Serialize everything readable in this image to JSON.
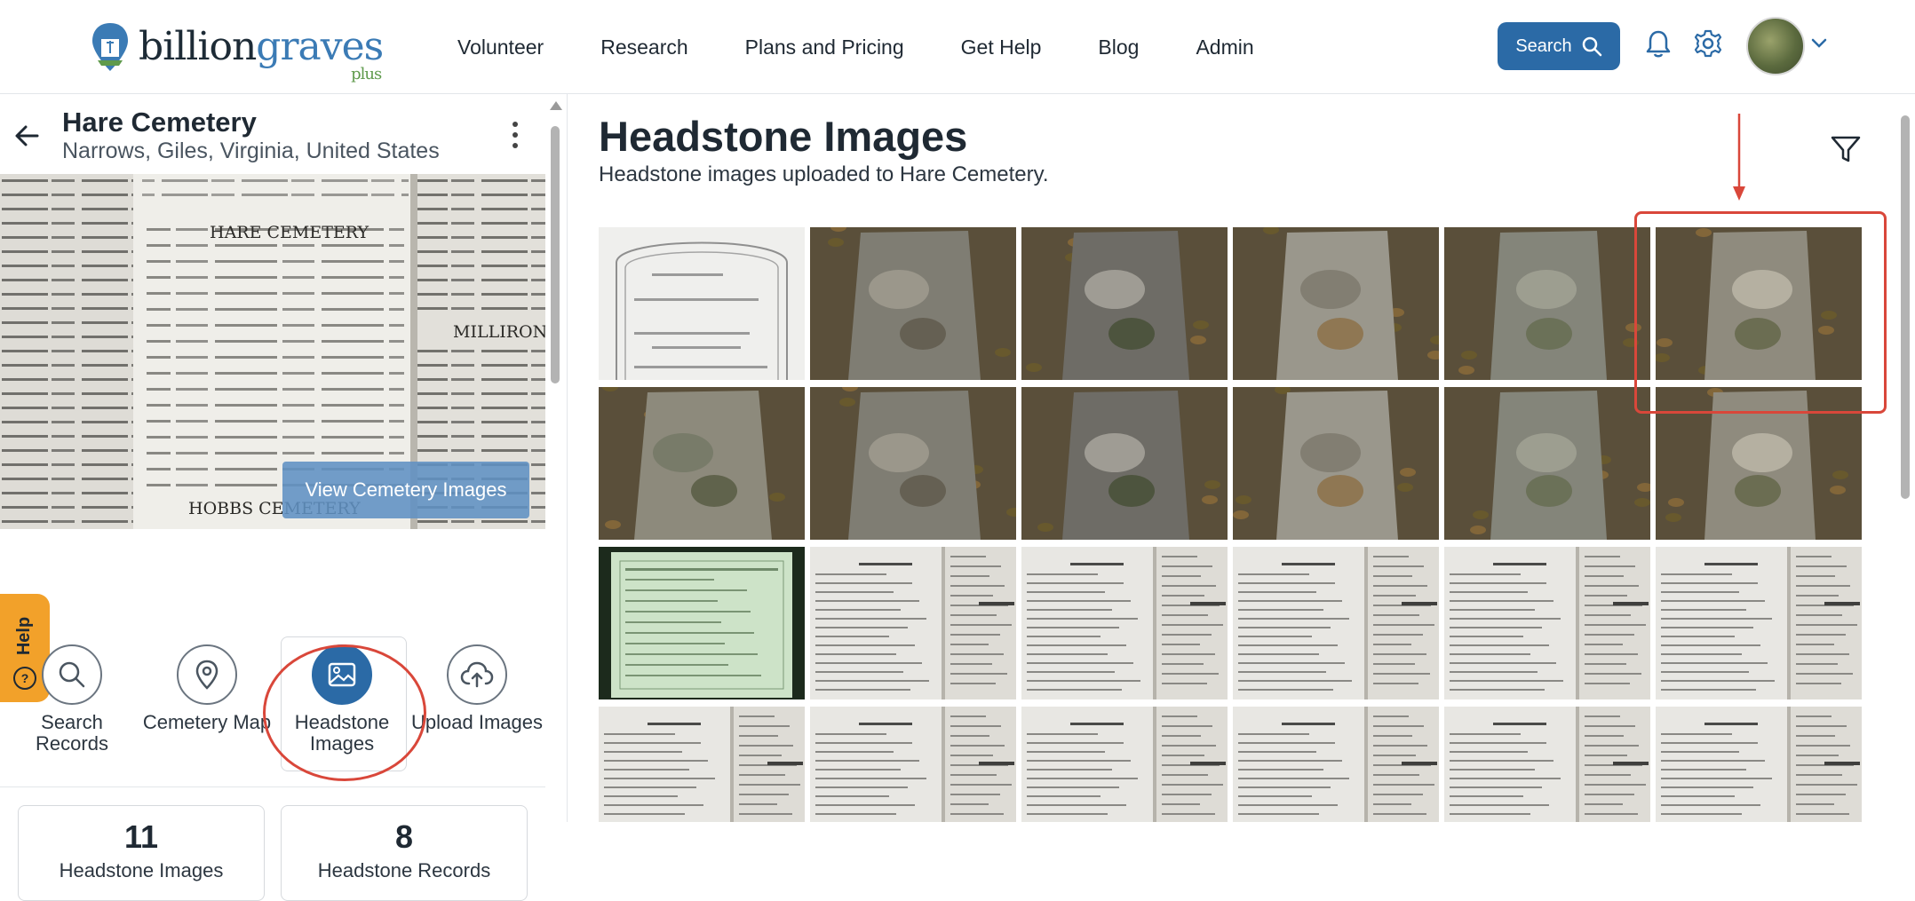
{
  "header": {
    "logo_text_dark": "billion",
    "logo_text_blue": "graves",
    "logo_plus": "plus",
    "nav": [
      "Volunteer",
      "Research",
      "Plans and Pricing",
      "Get Help",
      "Blog",
      "Admin"
    ],
    "search_label": "Search"
  },
  "left": {
    "title": "Hare Cemetery",
    "location": "Narrows, Giles, Virginia, United States",
    "view_images_label": "View Cemetery Images",
    "help_label": "Help",
    "actions": [
      {
        "label": "Search Records",
        "icon": "search-icon"
      },
      {
        "label": "Cemetery Map",
        "icon": "map-pin-icon"
      },
      {
        "label": "Headstone Images",
        "icon": "image-icon"
      },
      {
        "label": "Upload Images",
        "icon": "cloud-upload-icon"
      }
    ],
    "stats": [
      {
        "value": "11",
        "label": "Headstone Images"
      },
      {
        "value": "8",
        "label": "Headstone Records"
      }
    ],
    "book_text": {
      "heading": "HARE CEMETERY",
      "right_heading": "MILLIRON",
      "bottom_heading": "HOBBS CEMETERY"
    }
  },
  "main": {
    "title": "Headstone Images",
    "subtitle": "Headstone images uploaded to Hare Cemetery.",
    "rows": [
      [
        "drawing",
        "stone",
        "stone",
        "stone",
        "stone",
        "stone"
      ],
      [
        "stone",
        "stone",
        "stone",
        "stone",
        "stone",
        "stone"
      ],
      [
        "certificate",
        "book",
        "book",
        "book",
        "book",
        "book"
      ],
      [
        "book",
        "book",
        "book",
        "book",
        "book",
        "book"
      ]
    ]
  },
  "colors": {
    "accent": "#2b6aa6",
    "help": "#f2a12a",
    "annotation": "#d9473a"
  }
}
